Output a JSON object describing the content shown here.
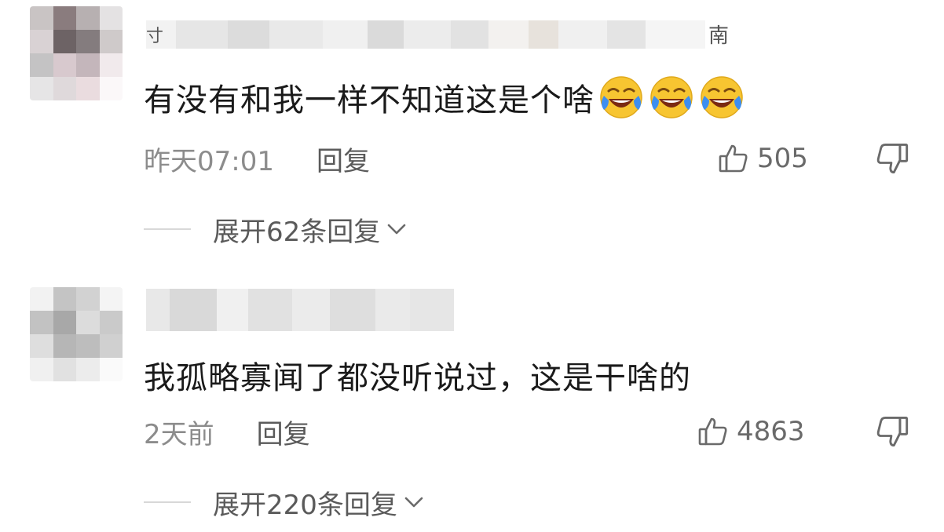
{
  "comments": [
    {
      "user_first_char": "寸",
      "location_tail": "南",
      "text": "有没有和我一样不知道这是个啥",
      "emoji": [
        "laughing-crying-emoji",
        "laughing-crying-emoji",
        "laughing-crying-emoji"
      ],
      "time": "昨天07:01",
      "reply_label": "回复",
      "likes": "505",
      "expand_label": "展开62条回复"
    },
    {
      "text": "我孤略寡闻了都没听说过，这是干啥的",
      "time": "2天前",
      "reply_label": "回复",
      "likes": "4863",
      "expand_label": "展开220条回复"
    }
  ],
  "colors": {
    "text": "#1a1a1a",
    "meta": "#8c8c8c",
    "emoji_face": "#f7c531",
    "emoji_tear": "#3d8ef0"
  }
}
